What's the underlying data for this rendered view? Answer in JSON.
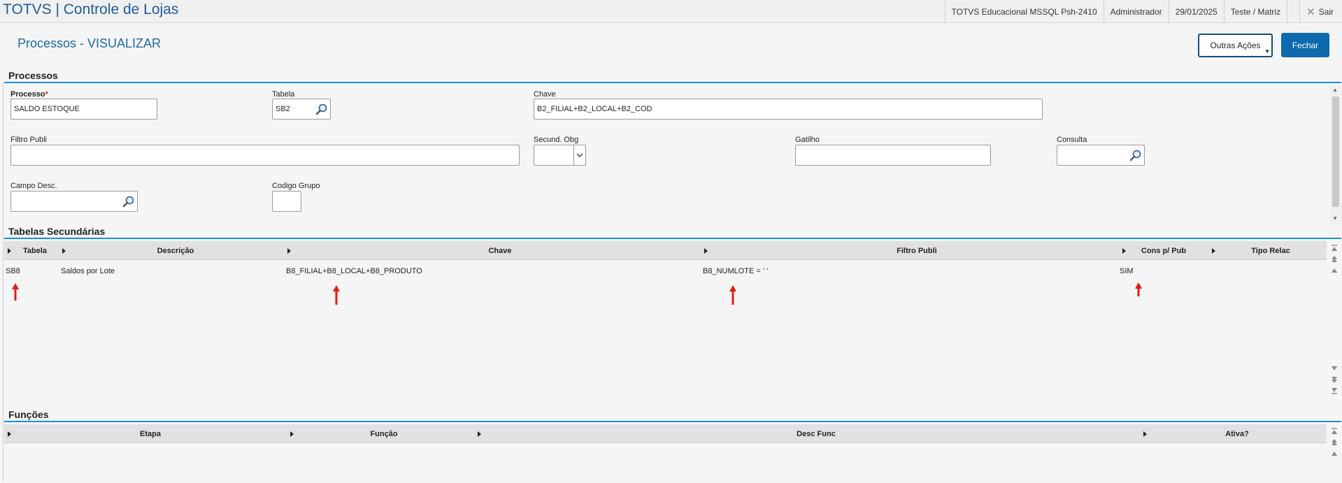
{
  "app": {
    "title": "TOTVS | Controle de Lojas",
    "environment": "TOTVS Educacional MSSQL Psh-2410",
    "user": "Administrador",
    "date": "29/01/2025",
    "branch": "Teste / Matriz",
    "exit_label": "Sair"
  },
  "header": {
    "page_title": "Processos - VISUALIZAR",
    "outras_acoes_label": "Outras Ações",
    "fechar_label": "Fechar"
  },
  "section_processos": {
    "title": "Processos",
    "fields": {
      "processo": {
        "label": "Processo",
        "required_mark": "*",
        "value": "SALDO ESTOQUE"
      },
      "tabela": {
        "label": "Tabela",
        "value": "SB2"
      },
      "chave": {
        "label": "Chave",
        "value": "B2_FILIAL+B2_LOCAL+B2_COD"
      },
      "filtro_publi": {
        "label": "Filtro Publi",
        "value": ""
      },
      "secund_obg": {
        "label": "Secund. Obg",
        "value": ""
      },
      "gatilho": {
        "label": "Gatilho",
        "value": ""
      },
      "consulta": {
        "label": "Consulta",
        "value": ""
      },
      "campo_desc": {
        "label": "Campo Desc.",
        "value": ""
      },
      "codigo_grupo": {
        "label": "Codigo Grupo",
        "value": ""
      }
    }
  },
  "section_tabelas": {
    "title": "Tabelas Secundárias",
    "columns": [
      "Tabela",
      "Descrição",
      "Chave",
      "Filtro Publi",
      "Cons p/ Pub",
      "Tipo Relac"
    ],
    "rows": [
      {
        "tabela": "SB8",
        "descricao": "Saldos por Lote",
        "chave": "B8_FILIAL+B8_LOCAL+B8_PRODUTO",
        "filtro_publi": "B8_NUMLOTE = ' '",
        "cons_pub": "SIM",
        "tipo_relac": ""
      }
    ]
  },
  "section_funcoes": {
    "title": "Funções",
    "columns": [
      "Etapa",
      "Função",
      "Desc Func",
      "Ativa?"
    ]
  },
  "colors": {
    "brand": "#1f5c99",
    "accent_line": "#1a8fd6",
    "primary_button": "#0c6aad",
    "annotation_arrow": "#e31b1b"
  }
}
